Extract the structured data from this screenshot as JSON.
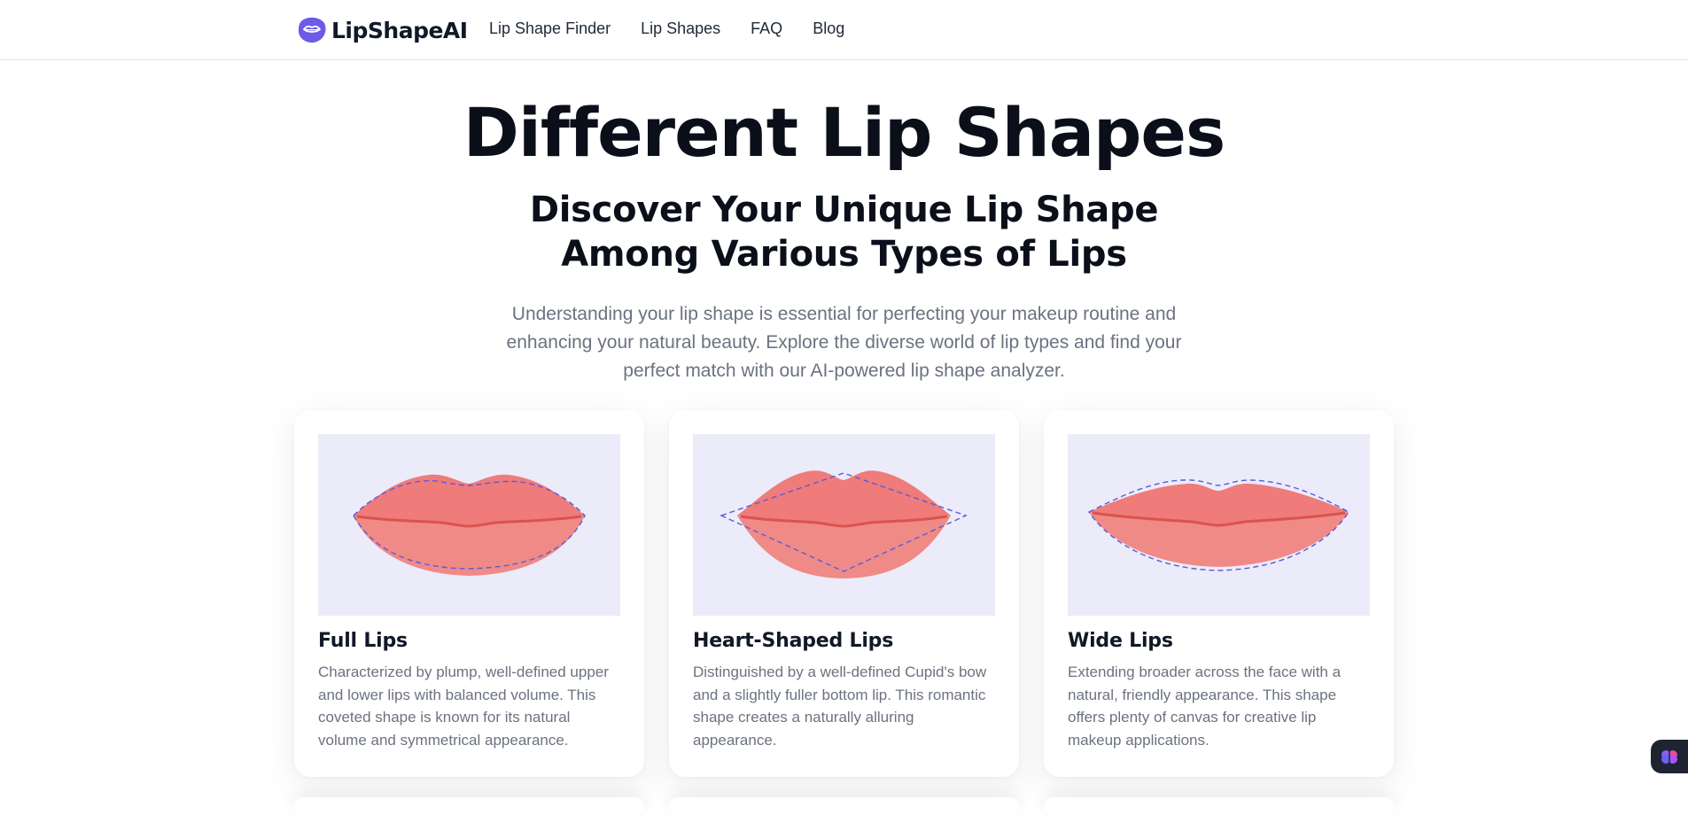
{
  "header": {
    "brand_name": "LipShapeAI",
    "nav": [
      {
        "label": "Lip Shape Finder"
      },
      {
        "label": "Lip Shapes"
      },
      {
        "label": "FAQ"
      },
      {
        "label": "Blog"
      }
    ]
  },
  "hero": {
    "title": "Different Lip Shapes",
    "subtitle": "Discover Your Unique Lip Shape Among Various Types of Lips",
    "description": "Understanding your lip shape is essential for perfecting your makeup routine and enhancing your natural beauty. Explore the diverse world of lip types and find your perfect match with our AI-powered lip shape analyzer."
  },
  "cards": [
    {
      "title": "Full Lips",
      "description": "Characterized by plump, well-defined upper and lower lips with balanced volume. This coveted shape is known for its natural volume and symmetrical appearance.",
      "icon": "full-lips-illustration"
    },
    {
      "title": "Heart-Shaped Lips",
      "description": "Distinguished by a well-defined Cupid's bow and a slightly fuller bottom lip. This romantic shape creates a naturally alluring appearance.",
      "icon": "heart-shaped-lips-illustration"
    },
    {
      "title": "Wide Lips",
      "description": "Extending broader across the face with a natural, friendly appearance. This shape offers plenty of canvas for creative lip makeup applications.",
      "icon": "wide-lips-illustration"
    }
  ],
  "colors": {
    "accent": "#6d5ae6",
    "lip_upper": "#ef7b7a",
    "lip_lower": "#f08a86",
    "lip_line": "#d9534f",
    "image_bg": "#ecebf9",
    "outline": "#5b5bd6"
  },
  "widget": {
    "icon": "brain-icon"
  }
}
